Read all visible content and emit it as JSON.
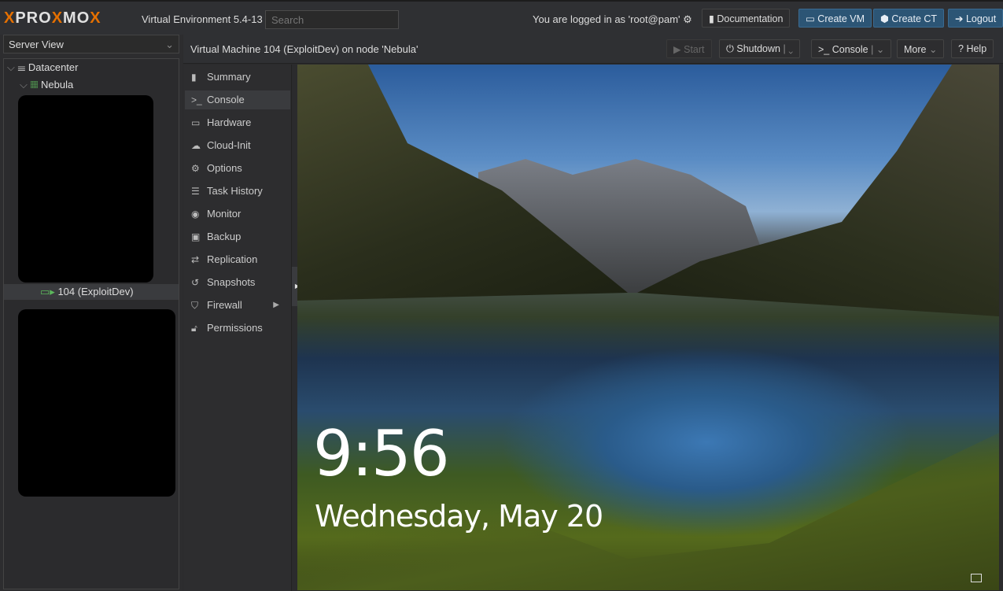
{
  "header": {
    "brand": "PROXMOX",
    "version": "Virtual Environment 5.4-13",
    "search_placeholder": "Search",
    "login_text": "You are logged in as 'root@pam'",
    "buttons": {
      "documentation": "Documentation",
      "create_vm": "Create VM",
      "create_ct": "Create CT",
      "logout": "Logout"
    },
    "accent": "#e57000"
  },
  "sidebar": {
    "view": "Server View",
    "tree": [
      {
        "label": "Datacenter",
        "icon": "server-rack-icon"
      },
      {
        "label": "Nebula",
        "icon": "node-online-icon"
      },
      {
        "label": "104 (ExploitDev)",
        "icon": "vm-running-icon",
        "selected": true
      }
    ]
  },
  "content": {
    "title": "Virtual Machine 104 (ExploitDev) on node 'Nebula'",
    "toolbar": {
      "start": "Start",
      "shutdown": "Shutdown",
      "console": "Console",
      "more": "More",
      "help": "Help"
    },
    "menu": [
      {
        "label": "Summary",
        "icon": "book-icon"
      },
      {
        "label": "Console",
        "icon": "terminal-icon",
        "selected": true
      },
      {
        "label": "Hardware",
        "icon": "monitor-icon"
      },
      {
        "label": "Cloud-Init",
        "icon": "cloud-icon"
      },
      {
        "label": "Options",
        "icon": "gear-icon"
      },
      {
        "label": "Task History",
        "icon": "list-icon"
      },
      {
        "label": "Monitor",
        "icon": "eye-icon"
      },
      {
        "label": "Backup",
        "icon": "floppy-icon"
      },
      {
        "label": "Replication",
        "icon": "retweet-icon"
      },
      {
        "label": "Snapshots",
        "icon": "history-icon"
      },
      {
        "label": "Firewall",
        "icon": "shield-icon"
      },
      {
        "label": "Permissions",
        "icon": "unlock-icon"
      }
    ]
  },
  "console": {
    "time": "9:56",
    "date": "Wednesday, May 20"
  }
}
